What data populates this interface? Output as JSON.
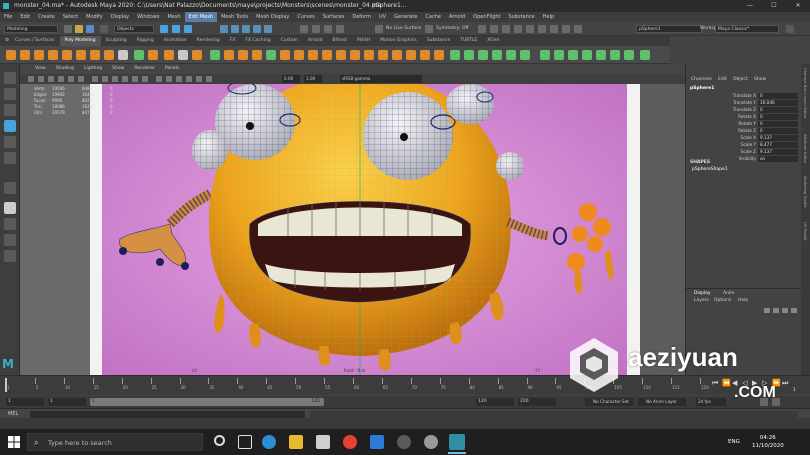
{
  "window": {
    "title": "monster_04.ma* - Autodesk Maya 2020: C:\\Users\\Nat Palazzo\\Documents\\maya\\projects\\Monsters\\scenes\\monster_04.ma",
    "center_label": "pSphere1...",
    "controls": [
      "—",
      "☐",
      "✕"
    ]
  },
  "menu": [
    "File",
    "Edit",
    "Create",
    "Select",
    "Modify",
    "Display",
    "Windows",
    "Mesh",
    "Edit Mesh",
    "Mesh Tools",
    "Mesh Display",
    "Curves",
    "Surfaces",
    "Deform",
    "UV",
    "Generate",
    "Cache",
    "Arnold",
    "OpenFlight",
    "Substance",
    "Help"
  ],
  "status": {
    "mode": "Modeling",
    "objects": "Objects",
    "no_live_surface": "No Live Surface",
    "symmetry": "Symmetry: Off",
    "object_field": "pSphere1",
    "workspace_label": "Workspace :",
    "workspace_value": "Maya Classic*"
  },
  "shelf_tabs": [
    "Curves / Surfaces",
    "Poly Modeling",
    "Sculpting",
    "Rigging",
    "Animation",
    "Rendering",
    "FX",
    "FX Caching",
    "Custom",
    "Arnold",
    "Bifrost",
    "MASH",
    "Motion Graphics",
    "Substance",
    "TURTLE",
    "XGen"
  ],
  "shelf_active": "Poly Modeling",
  "panel_menu": [
    "View",
    "Shading",
    "Lighting",
    "Show",
    "Renderer",
    "Panels"
  ],
  "panel_tools": {
    "field_a": "0.00",
    "field_b": "1.00",
    "color_space": "sRGB gamma"
  },
  "hud": {
    "rows": [
      {
        "label": "Verts:",
        "a": "10046",
        "b": "8482",
        "c": "0"
      },
      {
        "label": "Edges:",
        "a": "19942",
        "b": "16401",
        "c": "0"
      },
      {
        "label": "Faces:",
        "a": "9906",
        "b": "8020",
        "c": "0"
      },
      {
        "label": "Tris:",
        "a": "18086",
        "b": "16280",
        "c": "0"
      },
      {
        "label": "UVs:",
        "a": "10579",
        "b": "8477",
        "c": "0"
      }
    ],
    "left_num_top": "20",
    "left_num_bottom": "15",
    "viewport_tick_left": "80",
    "viewport_tick_right": "40",
    "camera_label": "front - 9 m"
  },
  "channel_box": {
    "tabs": [
      "Channels",
      "Edit",
      "Object",
      "Show"
    ],
    "object_name": "pSphere1",
    "attributes": [
      {
        "name": "Translate X",
        "value": "0"
      },
      {
        "name": "Translate Y",
        "value": "16.046"
      },
      {
        "name": "Translate Z",
        "value": "0"
      },
      {
        "name": "Rotate X",
        "value": "0"
      },
      {
        "name": "Rotate Y",
        "value": "0"
      },
      {
        "name": "Rotate Z",
        "value": "0"
      },
      {
        "name": "Scale X",
        "value": "9.137"
      },
      {
        "name": "Scale Y",
        "value": "8.477"
      },
      {
        "name": "Scale Z",
        "value": "9.137"
      },
      {
        "name": "Visibility",
        "value": "on"
      }
    ],
    "shapes_label": "SHAPES",
    "shape_name": "pSphereShape1",
    "layer_tabs": [
      "Display",
      "Anim"
    ],
    "layer_menu": [
      "Layers",
      "Options",
      "Help"
    ],
    "side_tabs": [
      "Channel Box / Layer Editor",
      "Attribute Editor",
      "Modelling Toolkit",
      "UV Toolkit"
    ]
  },
  "timeline": {
    "ticks": [
      "1",
      "5",
      "10",
      "15",
      "20",
      "25",
      "30",
      "35",
      "40",
      "45",
      "50",
      "55",
      "60",
      "65",
      "70",
      "75",
      "80",
      "85",
      "90",
      "95",
      "100",
      "105",
      "110",
      "115",
      "120"
    ],
    "current_frame": "1"
  },
  "range": {
    "start": "1",
    "start_inner": "1",
    "end_inner": "120",
    "end": "120",
    "end_total": "200",
    "character_set": "No Character Set",
    "anim_layer": "No Anim Layer",
    "fps": "24 fps"
  },
  "command_line": {
    "lang": "MEL"
  },
  "taskbar": {
    "search_placeholder": "Type here to search",
    "lang": "ENG",
    "time": "04:26",
    "date": "11/10/2020"
  },
  "watermark": {
    "top": "aeziyuan",
    "bottom": ".COM"
  },
  "colors": {
    "bg_pink": "#d98fd8",
    "monster_orange": "#f0a020",
    "wire_green": "#36c98a",
    "accent_blue": "#4aa3df"
  }
}
